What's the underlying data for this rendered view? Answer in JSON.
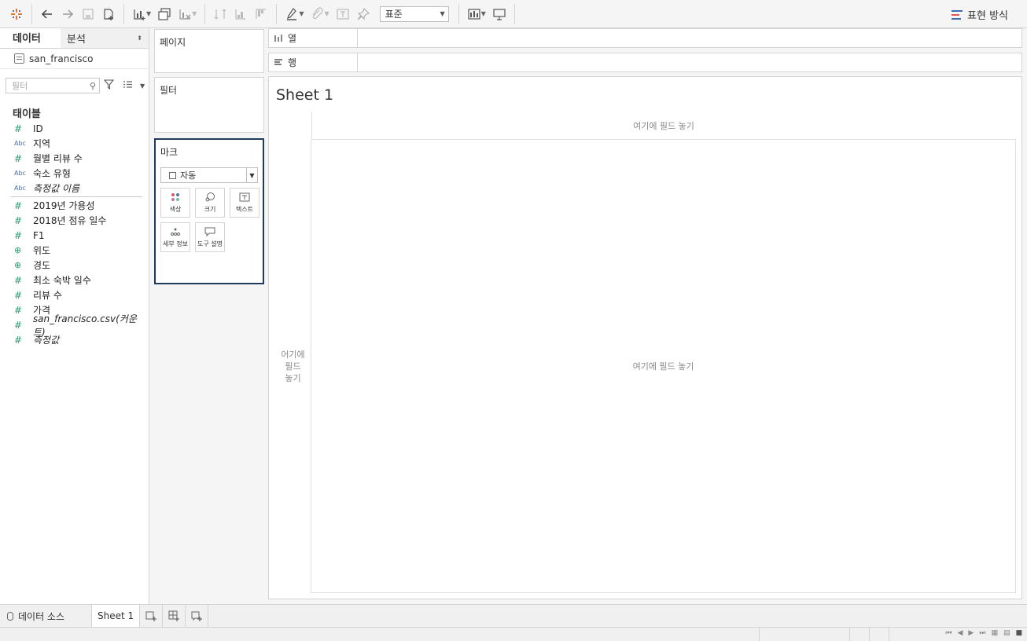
{
  "toolbar": {
    "standard_select": "표준",
    "show_me_label": "표현 방식"
  },
  "data_pane": {
    "tab_data": "데이터",
    "tab_analysis": "분석",
    "datasource": "san_francisco",
    "search_placeholder": "필터",
    "tables_title": "태이블",
    "dimensions": [
      {
        "type": "#",
        "label": "ID"
      },
      {
        "type": "Abc",
        "label": "지역"
      },
      {
        "type": "#",
        "label": "월별 리뷰 수"
      },
      {
        "type": "Abc",
        "label": "숙소 유형"
      },
      {
        "type": "Abc",
        "label": "측정값 이름"
      }
    ],
    "measures": [
      {
        "type": "#",
        "label": "2019년 가용성"
      },
      {
        "type": "#",
        "label": "2018년 점유 일수"
      },
      {
        "type": "#",
        "label": "F1"
      },
      {
        "type": "geo",
        "label": "위도"
      },
      {
        "type": "geo",
        "label": "경도"
      },
      {
        "type": "#",
        "label": "최소 숙박 일수"
      },
      {
        "type": "#",
        "label": "리뷰 수"
      },
      {
        "type": "#",
        "label": "가격"
      },
      {
        "type": "#",
        "label": "san_francisco.csv(커운트)"
      },
      {
        "type": "#",
        "label": "측정값"
      }
    ]
  },
  "shelves": {
    "pages": "페이지",
    "filters": "필터",
    "marks": "마크",
    "marks_type": "자동",
    "columns": "열",
    "rows": "행"
  },
  "marks_buttons": {
    "color": "색상",
    "size": "크기",
    "text": "텍스트",
    "detail": "세부 정보",
    "tooltip": "도구 설명"
  },
  "sheet": {
    "title": "Sheet 1",
    "drop_top": "여기에 필드 놓기",
    "drop_left": "어기에 필드 놓기",
    "drop_main": "여기에 필드 놓기"
  },
  "bottom_tabs": {
    "datasource_tab": "데이터 소스",
    "sheet_tab": "Sheet 1"
  },
  "colors": {
    "marks_border": "#1f3b5c",
    "field_green": "#2c9a78",
    "field_blue": "#4a6fa5"
  }
}
